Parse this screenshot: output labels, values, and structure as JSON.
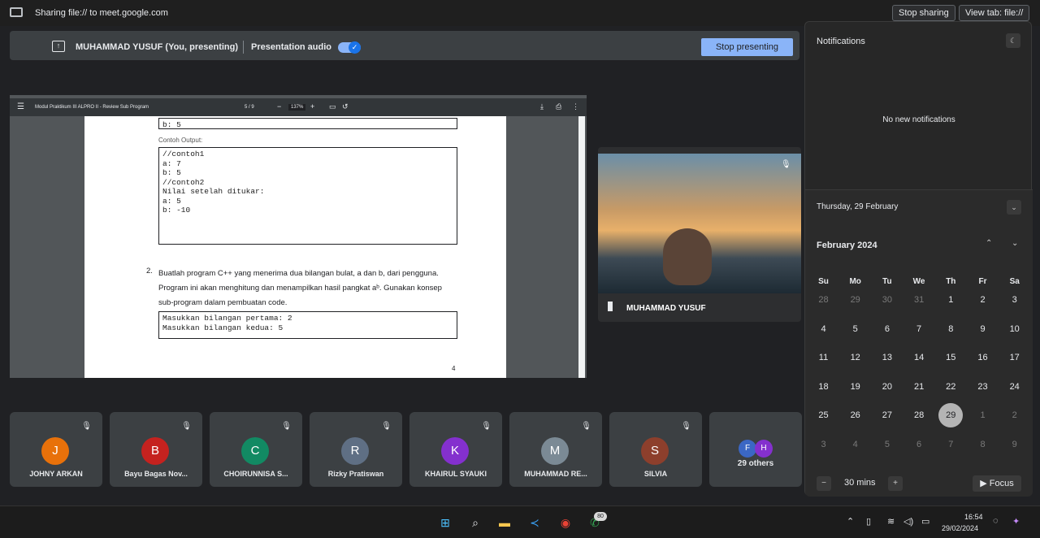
{
  "share_bar": {
    "text": "Sharing file:// to meet.google.com",
    "stop_sharing": "Stop sharing",
    "view_tab": "View tab: file://"
  },
  "present_bar": {
    "presenter": "MUHAMMAD YUSUF (You, presenting)",
    "audio_label": "Presentation audio",
    "audio_on": true,
    "stop_button": "Stop presenting"
  },
  "pdf": {
    "title": "Modul Praktikum III ALPRO II - Review Sub Program",
    "page": "5 / 9",
    "zoom": "137%",
    "top_line": "b: 5",
    "example_label": "Contoh Output:",
    "code1": "//contoh1\na: 7\nb: 5\n//contoh2\nNilai setelah ditukar:\na: 5\nb: -10",
    "question_num": "2.",
    "question": "Buatlah program C++ yang menerima dua bilangan bulat, a dan b, dari pengguna. Program ini akan menghitung dan menampilkan hasil pangkat aᵇ. Gunakan konsep sub-program dalam pembuatan code.",
    "code2": "Masukkan bilangan pertama: 2\nMasukkan bilangan kedua: 5",
    "page_footer": "4"
  },
  "main_video": {
    "name": "MUHAMMAD YUSUF"
  },
  "participants": [
    {
      "initial": "J",
      "name": "JOHNY ARKAN",
      "color": "#e8710a"
    },
    {
      "initial": "B",
      "name": "Bayu Bagas Nov...",
      "color": "#c5221f"
    },
    {
      "initial": "C",
      "name": "CHOIRUNNISA S...",
      "color": "#128a63"
    },
    {
      "initial": "R",
      "name": "Rizky Pratiswan",
      "color": "#5f6f84"
    },
    {
      "initial": "K",
      "name": "KHAIRUL SYAUKI",
      "color": "#8430ce"
    },
    {
      "initial": "M",
      "name": "MUHAMMAD RE...",
      "color": "#7b8a95"
    },
    {
      "initial": "S",
      "name": "SILVIA",
      "color": "#8d3f2c"
    }
  ],
  "others": {
    "count_label": "29 others",
    "dots": [
      {
        "initial": "F",
        "color": "#3b67c4"
      },
      {
        "initial": "H",
        "color": "#8430ce"
      }
    ]
  },
  "notifications": {
    "title": "Notifications",
    "empty": "No new notifications"
  },
  "calendar": {
    "date_label": "Thursday, 29 February",
    "month": "February 2024",
    "weekdays": [
      "Su",
      "Mo",
      "Tu",
      "We",
      "Th",
      "Fr",
      "Sa"
    ],
    "weeks": [
      [
        "28",
        "29",
        "30",
        "31",
        "1",
        "2",
        "3"
      ],
      [
        "4",
        "5",
        "6",
        "7",
        "8",
        "9",
        "10"
      ],
      [
        "11",
        "12",
        "13",
        "14",
        "15",
        "16",
        "17"
      ],
      [
        "18",
        "19",
        "20",
        "21",
        "22",
        "23",
        "24"
      ],
      [
        "25",
        "26",
        "27",
        "28",
        "29",
        "1",
        "2"
      ],
      [
        "3",
        "4",
        "5",
        "6",
        "7",
        "8",
        "9"
      ]
    ],
    "today": "29",
    "focus_minutes": "30 mins",
    "focus_label": "Focus"
  },
  "taskbar": {
    "badge": "80",
    "time": "16:54",
    "date": "29/02/2024"
  }
}
